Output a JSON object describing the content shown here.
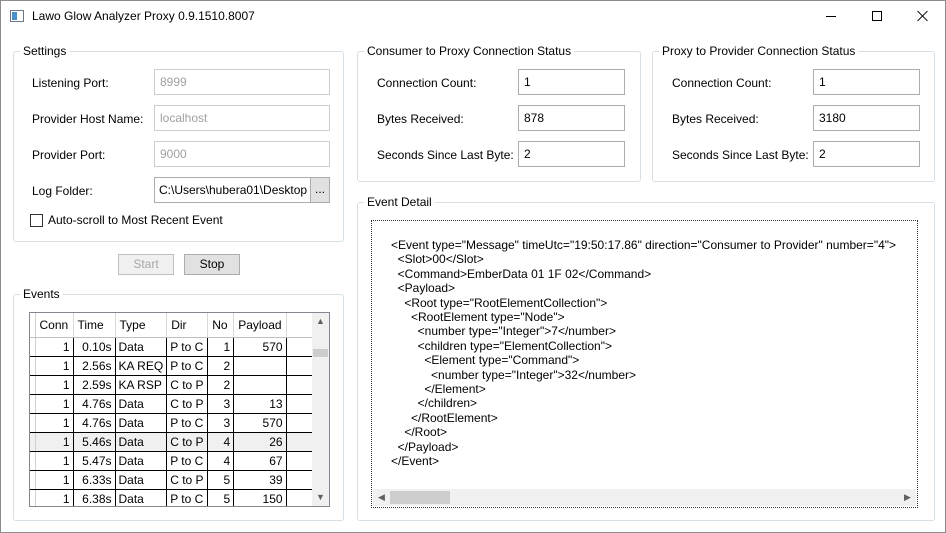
{
  "window": {
    "title": "Lawo Glow Analyzer Proxy 0.9.1510.8007"
  },
  "settings": {
    "title": "Settings",
    "listening_port_label": "Listening Port:",
    "listening_port_value": "8999",
    "provider_host_label": "Provider Host Name:",
    "provider_host_value": "localhost",
    "provider_port_label": "Provider Port:",
    "provider_port_value": "9000",
    "log_folder_label": "Log Folder:",
    "log_folder_value": "C:\\Users\\hubera01\\Desktop",
    "browse_label": "...",
    "autoscroll_label": "Auto-scroll to Most Recent Event",
    "autoscroll_checked": false
  },
  "controls": {
    "start_label": "Start",
    "stop_label": "Stop"
  },
  "consumer_status": {
    "title": "Consumer to Proxy Connection Status",
    "connection_count_label": "Connection Count:",
    "connection_count_value": "1",
    "bytes_received_label": "Bytes Received:",
    "bytes_received_value": "878",
    "seconds_label": "Seconds Since Last Byte:",
    "seconds_value": "2"
  },
  "provider_status": {
    "title": "Proxy to Provider Connection Status",
    "connection_count_label": "Connection Count:",
    "connection_count_value": "1",
    "bytes_received_label": "Bytes Received:",
    "bytes_received_value": "3180",
    "seconds_label": "Seconds Since Last Byte:",
    "seconds_value": "2"
  },
  "events": {
    "title": "Events",
    "columns": [
      "Conn",
      "Time",
      "Type",
      "Dir",
      "No",
      "Payload"
    ],
    "rows": [
      [
        "1",
        "0.10s",
        "Data",
        "P to C",
        "1",
        "570"
      ],
      [
        "1",
        "2.56s",
        "KA REQ",
        "P to C",
        "2",
        ""
      ],
      [
        "1",
        "2.59s",
        "KA RSP",
        "C to P",
        "2",
        ""
      ],
      [
        "1",
        "4.76s",
        "Data",
        "C to P",
        "3",
        "13"
      ],
      [
        "1",
        "4.76s",
        "Data",
        "P to C",
        "3",
        "570"
      ],
      [
        "1",
        "5.46s",
        "Data",
        "C to P",
        "4",
        "26"
      ],
      [
        "1",
        "5.47s",
        "Data",
        "P to C",
        "4",
        "67"
      ],
      [
        "1",
        "6.33s",
        "Data",
        "C to P",
        "5",
        "39"
      ],
      [
        "1",
        "6.38s",
        "Data",
        "P to C",
        "5",
        "150"
      ]
    ],
    "selected_row": 5
  },
  "event_detail": {
    "title": "Event Detail",
    "lines": [
      "<Event type=\"Message\" timeUtc=\"19:50:17.86\" direction=\"Consumer to Provider\" number=\"4\">",
      "  <Slot>00</Slot>",
      "  <Command>EmberData 01 1F 02</Command>",
      "  <Payload>",
      "    <Root type=\"RootElementCollection\">",
      "      <RootElement type=\"Node\">",
      "        <number type=\"Integer\">7</number>",
      "        <children type=\"ElementCollection\">",
      "          <Element type=\"Command\">",
      "            <number type=\"Integer\">32</number>",
      "          </Element>",
      "        </children>",
      "      </RootElement>",
      "    </Root>",
      "  </Payload>",
      "</Event>"
    ]
  }
}
